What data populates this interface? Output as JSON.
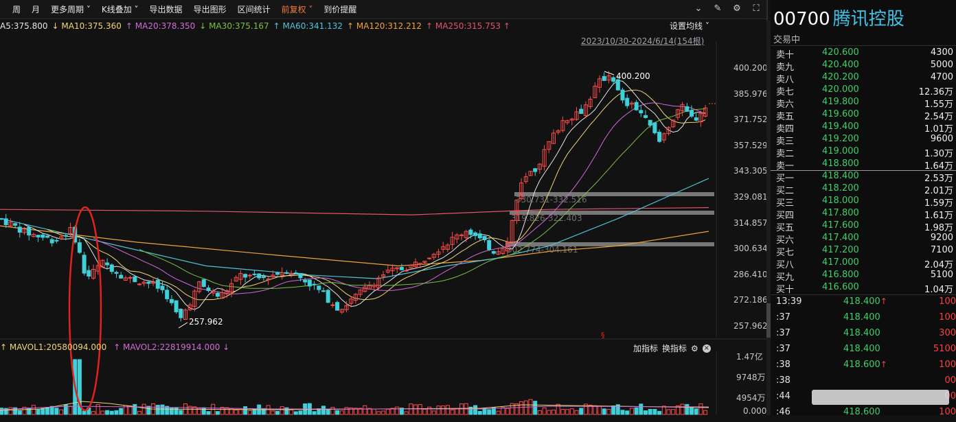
{
  "toolbar": {
    "items": [
      "周",
      "月",
      "更多周期 ˅",
      "K线叠加 ˅",
      "导出数据",
      "导出图形",
      "区间统计",
      "前复权 ˅",
      "到价提醒"
    ],
    "active_index": 7
  },
  "ma_legend": {
    "items": [
      {
        "text": "A5:375.800",
        "color": "#e6e6e6"
      },
      {
        "text": "↓ MA10:375.360",
        "color": "#f2d675"
      },
      {
        "text": "↑ MA20:378.350",
        "color": "#d36bd8"
      },
      {
        "text": "↓ MA30:375.167",
        "color": "#7bc043"
      },
      {
        "text": "↑ MA60:341.132",
        "color": "#4fc3d9"
      },
      {
        "text": "↑ MA120:312.212",
        "color": "#f2a43a"
      },
      {
        "text": "↑ MA250:315.753 ↑",
        "color": "#e0566c"
      }
    ],
    "settings_label": "设置均线 ˅"
  },
  "range_label": "2023/10/30-2024/6/14(154根)",
  "price_axis": [
    "400.200",
    "385.976",
    "371.752",
    "357.529",
    "343.305",
    "329.081",
    "314.857",
    "300.634",
    "286.410",
    "272.186",
    "257.962"
  ],
  "annotations": {
    "high": "400.200",
    "low": "257.962",
    "zones": [
      "330.731-332.516",
      "319.826-322.403",
      "302.774-304.161"
    ]
  },
  "volume_header": {
    "mavol1": "MAVOL1:20580094.000",
    "mavol2": "MAVOL2:22819914.000",
    "add_indicator": "加指标",
    "switch_indicator": "换指标"
  },
  "volume_axis": [
    "1.47亿",
    "9748万",
    "4954万",
    "0.000"
  ],
  "stock": {
    "code": "00700",
    "name": "腾讯控股",
    "status": "交易中"
  },
  "order_book": {
    "asks": [
      {
        "label": "卖十",
        "price": "420.600",
        "vol": "4300"
      },
      {
        "label": "卖九",
        "price": "420.400",
        "vol": "5000"
      },
      {
        "label": "卖八",
        "price": "420.200",
        "vol": "4700"
      },
      {
        "label": "卖七",
        "price": "420.000",
        "vol": "12.36万"
      },
      {
        "label": "卖六",
        "price": "419.800",
        "vol": "1.55万"
      },
      {
        "label": "卖五",
        "price": "419.600",
        "vol": "2.54万"
      },
      {
        "label": "卖四",
        "price": "419.400",
        "vol": "1.01万"
      },
      {
        "label": "卖三",
        "price": "419.200",
        "vol": "9600"
      },
      {
        "label": "卖二",
        "price": "419.000",
        "vol": "1.30万"
      },
      {
        "label": "卖一",
        "price": "418.800",
        "vol": "1.64万"
      }
    ],
    "bids": [
      {
        "label": "买一",
        "price": "418.400",
        "vol": "2.53万"
      },
      {
        "label": "买二",
        "price": "418.200",
        "vol": "2.01万"
      },
      {
        "label": "买三",
        "price": "418.000",
        "vol": "1.59万"
      },
      {
        "label": "买四",
        "price": "417.800",
        "vol": "1.61万"
      },
      {
        "label": "买五",
        "price": "417.600",
        "vol": "1.98万"
      },
      {
        "label": "买六",
        "price": "417.400",
        "vol": "9200"
      },
      {
        "label": "买七",
        "price": "417.200",
        "vol": "7100"
      },
      {
        "label": "买八",
        "price": "417.000",
        "vol": "2.04万"
      },
      {
        "label": "买九",
        "price": "416.800",
        "vol": "5100"
      },
      {
        "label": "买十",
        "price": "416.600",
        "vol": "1.04万"
      }
    ]
  },
  "ticks": [
    {
      "time": "13:39",
      "price": "418.400",
      "arrow": "↑",
      "vol": "100"
    },
    {
      "time": ":37",
      "price": "418.400",
      "arrow": "",
      "vol": "100"
    },
    {
      "time": ":37",
      "price": "418.400",
      "arrow": "",
      "vol": "300"
    },
    {
      "time": ":37",
      "price": "418.400",
      "arrow": "",
      "vol": "5100"
    },
    {
      "time": ":38",
      "price": "418.600",
      "arrow": "↑",
      "vol": "100"
    },
    {
      "time": ":38",
      "price": "",
      "arrow": "",
      "vol": "00"
    },
    {
      "time": ":44",
      "price": "",
      "arrow": "",
      "vol": "00"
    },
    {
      "time": ":46",
      "price": "418.600",
      "arrow": "",
      "vol": "100"
    }
  ],
  "chart_data": {
    "type": "candlestick",
    "price_range": [
      257.962,
      400.2
    ],
    "ma_lines": {
      "MA250": [
        [
          0,
          323
        ],
        [
          300,
          322
        ],
        [
          600,
          320
        ],
        [
          800,
          323
        ],
        [
          1032,
          324
        ]
      ],
      "MA120": [
        [
          0,
          314
        ],
        [
          200,
          305
        ],
        [
          400,
          298
        ],
        [
          580,
          292
        ],
        [
          700,
          295
        ],
        [
          800,
          300
        ],
        [
          900,
          303
        ],
        [
          1032,
          311
        ]
      ],
      "MA60": [
        [
          0,
          318
        ],
        [
          150,
          305
        ],
        [
          300,
          292
        ],
        [
          450,
          287
        ],
        [
          550,
          285
        ],
        [
          650,
          292
        ],
        [
          720,
          296
        ],
        [
          800,
          303
        ],
        [
          900,
          318
        ],
        [
          1032,
          340
        ]
      ]
    }
  }
}
